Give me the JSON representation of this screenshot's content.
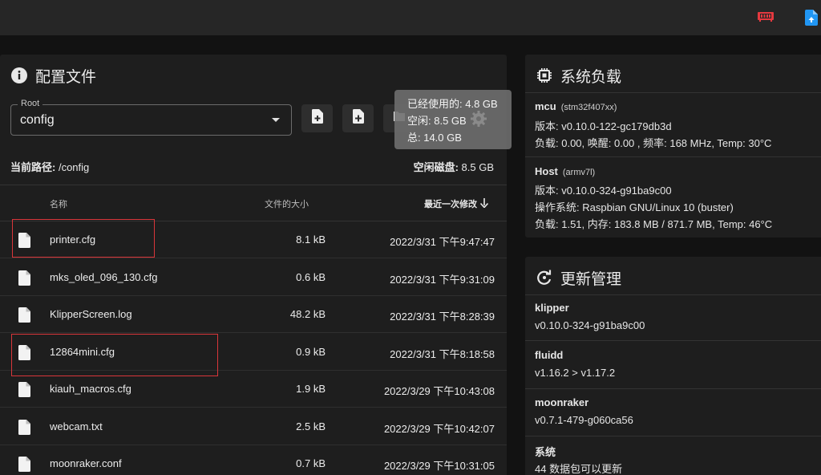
{
  "files_card": {
    "title": "配置文件",
    "root_legend": "Root",
    "root_value": "config",
    "current_path_label": "当前路径:",
    "current_path": "/config",
    "free_disk_label": "空闲磁盘:",
    "free_disk": "8.5 GB",
    "tooltip": {
      "used": "已经使用的: 4.8 GB",
      "free": "空闲: 8.5 GB",
      "total": "总: 14.0 GB"
    },
    "columns": {
      "name": "名称",
      "size": "文件的大小",
      "modified": "最近一次修改"
    },
    "rows": [
      {
        "name": "printer.cfg",
        "size": "8.1 kB",
        "modified": "2022/3/31 下午9:47:47"
      },
      {
        "name": "mks_oled_096_130.cfg",
        "size": "0.6 kB",
        "modified": "2022/3/31 下午9:31:09"
      },
      {
        "name": "KlipperScreen.log",
        "size": "48.2 kB",
        "modified": "2022/3/31 下午8:28:39"
      },
      {
        "name": "12864mini.cfg",
        "size": "0.9 kB",
        "modified": "2022/3/31 下午8:18:58"
      },
      {
        "name": "kiauh_macros.cfg",
        "size": "1.9 kB",
        "modified": "2022/3/29 下午10:43:08"
      },
      {
        "name": "webcam.txt",
        "size": "2.5 kB",
        "modified": "2022/3/29 下午10:42:07"
      },
      {
        "name": "moonraker.conf",
        "size": "0.7 kB",
        "modified": "2022/3/29 下午10:31:05"
      }
    ]
  },
  "system_card": {
    "title": "系统负载",
    "mcu": {
      "name": "mcu",
      "chip": "(stm32f407xx)",
      "version": "版本: v0.10.0-122-gc179db3d",
      "load": "负载: 0.00, 唤醒: 0.00 , 频率: 168 MHz, Temp: 30°C"
    },
    "host": {
      "name": "Host",
      "arch": "(armv7l)",
      "version": "版本: v0.10.0-324-g91ba9c00",
      "os": "操作系统: Raspbian GNU/Linux 10 (buster)",
      "load": "负载: 1.51, 内存: 183.8 MB / 871.7 MB, Temp: 46°C"
    }
  },
  "update_card": {
    "title": "更新管理",
    "items": [
      {
        "name": "klipper",
        "value": "v0.10.0-324-g91ba9c00"
      },
      {
        "name": "fluidd",
        "value": "v1.16.2 > v1.17.2"
      },
      {
        "name": "moonraker",
        "value": "v0.7.1-479-g060ca56"
      },
      {
        "name": "系统",
        "value": "44 数据包可以更新"
      }
    ]
  },
  "colors": {
    "background": "#121212",
    "card": "#1e1e1e",
    "topbar": "#262626",
    "highlight_box": "#d9363a",
    "usb_icon": "#e5393f",
    "file_icon": "#2196f3"
  },
  "icons": {
    "usb": "usb-device-icon",
    "file_upload": "file-upload-icon",
    "info": "info-icon",
    "chip": "chip-icon",
    "refresh": "refresh-icon",
    "add_file": "add-file-icon",
    "upload_file": "upload-file-icon",
    "add_folder": "add-folder-icon",
    "settings": "gear-icon",
    "file": "file-icon",
    "sort_down": "arrow-down-icon"
  }
}
